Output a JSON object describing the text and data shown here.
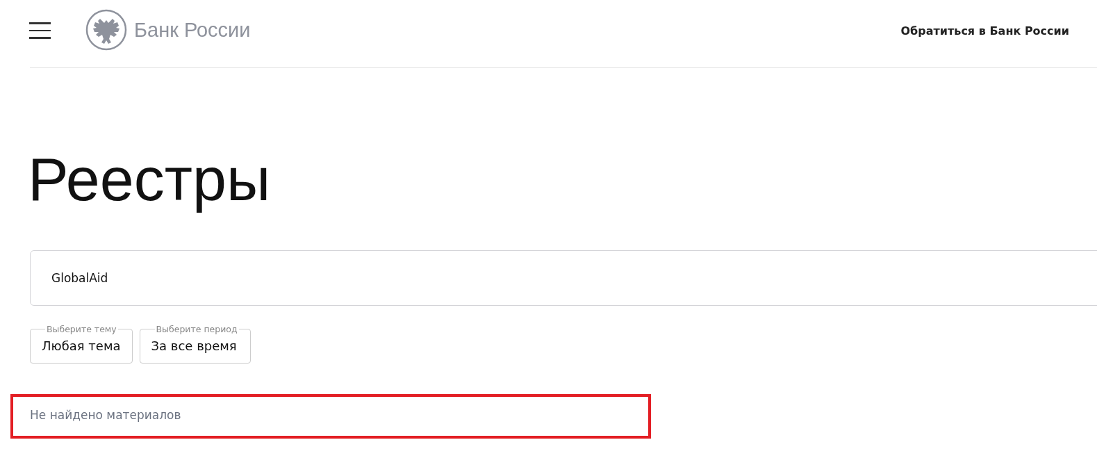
{
  "header": {
    "logo_text": "Банк России",
    "contact_link": "Обратиться в Банк России"
  },
  "page_title": "Реестры",
  "search": {
    "value": "GlobalAid"
  },
  "filters": [
    {
      "label": "Выберите тему",
      "value": "Любая тема"
    },
    {
      "label": "Выберите период",
      "value": "За все время"
    }
  ],
  "result": {
    "message": "Не найдено материалов",
    "highlighted": true
  }
}
